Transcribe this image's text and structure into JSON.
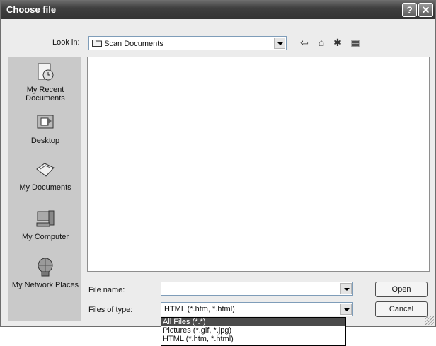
{
  "window": {
    "title": "Choose file"
  },
  "titlebar": {
    "help_glyph": "?",
    "close_glyph": "✕"
  },
  "lookin": {
    "label": "Look in:",
    "value": "Scan Documents"
  },
  "toolbar": {
    "back_glyph": "⇦",
    "up_glyph": "⌂",
    "newfolder_glyph": "✱",
    "views_glyph": "▦"
  },
  "places": [
    {
      "label": "My Recent Documents",
      "icon": "recent-documents-icon"
    },
    {
      "label": "Desktop",
      "icon": "desktop-icon"
    },
    {
      "label": "My Documents",
      "icon": "my-documents-icon"
    },
    {
      "label": "My Computer",
      "icon": "my-computer-icon"
    },
    {
      "label": "My Network Places",
      "icon": "network-places-icon"
    }
  ],
  "filename": {
    "label": "File name:",
    "value": ""
  },
  "filetype": {
    "label": "Files of type:",
    "value": "HTML (*.htm, *.html)",
    "options": [
      "All Files (*.*)",
      "Pictures (*.gif, *.jpg)",
      "HTML (*.htm, *.html)"
    ]
  },
  "buttons": {
    "open": "Open",
    "cancel": "Cancel"
  }
}
